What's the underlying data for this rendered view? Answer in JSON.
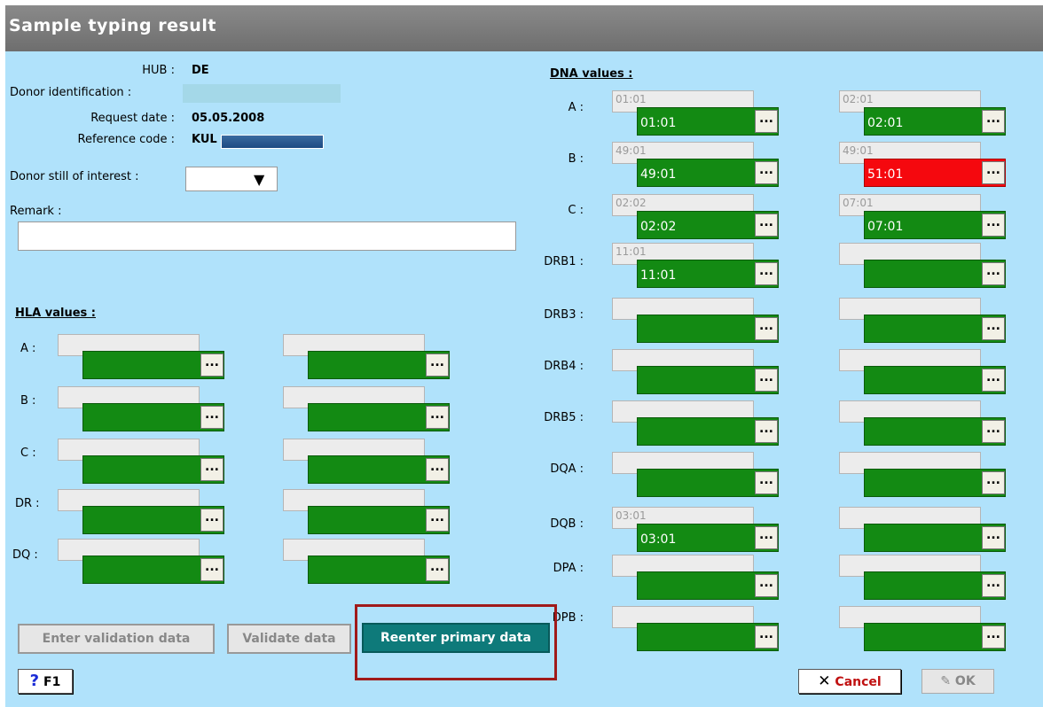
{
  "window": {
    "title": "Sample typing result"
  },
  "info": {
    "hub_label": "HUB :",
    "hub_value": "DE",
    "donor_id_label": "Donor identification :",
    "request_date_label": "Request date :",
    "request_date_value": "05.05.2008",
    "reference_code_label": "Reference code :",
    "reference_code_value": "KUL"
  },
  "interest": {
    "label": "Donor still of interest :",
    "value": ""
  },
  "remark": {
    "label": "Remark :",
    "value": ""
  },
  "hla": {
    "title": "HLA values :",
    "rows": [
      {
        "label": "A :",
        "fields": [
          {
            "primary": "",
            "secondary": ""
          },
          {
            "primary": "",
            "secondary": ""
          }
        ]
      },
      {
        "label": "B :",
        "fields": [
          {
            "primary": "",
            "secondary": ""
          },
          {
            "primary": "",
            "secondary": ""
          }
        ]
      },
      {
        "label": "C :",
        "fields": [
          {
            "primary": "",
            "secondary": ""
          },
          {
            "primary": "",
            "secondary": ""
          }
        ]
      },
      {
        "label": "DR :",
        "fields": [
          {
            "primary": "",
            "secondary": ""
          },
          {
            "primary": "",
            "secondary": ""
          }
        ]
      },
      {
        "label": "DQ :",
        "fields": [
          {
            "primary": "",
            "secondary": ""
          },
          {
            "primary": "",
            "secondary": ""
          }
        ]
      }
    ]
  },
  "dna": {
    "title": "DNA values :",
    "rows": [
      {
        "label": "A :",
        "fields": [
          {
            "primary": "01:01",
            "secondary": "01:01"
          },
          {
            "primary": "02:01",
            "secondary": "02:01"
          }
        ]
      },
      {
        "label": "B :",
        "fields": [
          {
            "primary": "49:01",
            "secondary": "49:01"
          },
          {
            "primary": "49:01",
            "secondary": "51:01",
            "mismatch": true
          }
        ]
      },
      {
        "label": "C :",
        "fields": [
          {
            "primary": "02:02",
            "secondary": "02:02"
          },
          {
            "primary": "07:01",
            "secondary": "07:01"
          }
        ]
      },
      {
        "label": "DRB1 :",
        "fields": [
          {
            "primary": "11:01",
            "secondary": "11:01"
          },
          {
            "primary": "",
            "secondary": ""
          }
        ]
      },
      {
        "label": "DRB3 :",
        "fields": [
          {
            "primary": "",
            "secondary": ""
          },
          {
            "primary": "",
            "secondary": ""
          }
        ]
      },
      {
        "label": "DRB4 :",
        "fields": [
          {
            "primary": "",
            "secondary": ""
          },
          {
            "primary": "",
            "secondary": ""
          }
        ]
      },
      {
        "label": "DRB5 :",
        "fields": [
          {
            "primary": "",
            "secondary": ""
          },
          {
            "primary": "",
            "secondary": ""
          }
        ]
      },
      {
        "label": "DQA :",
        "fields": [
          {
            "primary": "",
            "secondary": ""
          },
          {
            "primary": "",
            "secondary": ""
          }
        ]
      },
      {
        "label": "DQB :",
        "fields": [
          {
            "primary": "03:01",
            "secondary": "03:01"
          },
          {
            "primary": "",
            "secondary": ""
          }
        ]
      },
      {
        "label": "DPA :",
        "fields": [
          {
            "primary": "",
            "secondary": ""
          },
          {
            "primary": "",
            "secondary": ""
          }
        ]
      },
      {
        "label": "DPB :",
        "fields": [
          {
            "primary": "",
            "secondary": ""
          },
          {
            "primary": "",
            "secondary": ""
          }
        ]
      }
    ]
  },
  "ellipsis": "...",
  "buttons": {
    "enter_validation": "Enter validation data",
    "validate": "Validate data",
    "reenter_primary": "Reenter primary data",
    "help": "F1",
    "help_glyph": "?",
    "cancel": "Cancel",
    "cancel_glyph": "✕",
    "ok": "OK",
    "ok_glyph": "✎"
  },
  "colors": {
    "panel": "#b0e2fb",
    "green": "#138a13",
    "red": "#f5080e",
    "teal": "#0e7a7a"
  },
  "icons": {
    "dropdown": "caret-down-icon",
    "help": "question-icon",
    "cancel": "x-icon",
    "ok": "edit-check-icon"
  }
}
